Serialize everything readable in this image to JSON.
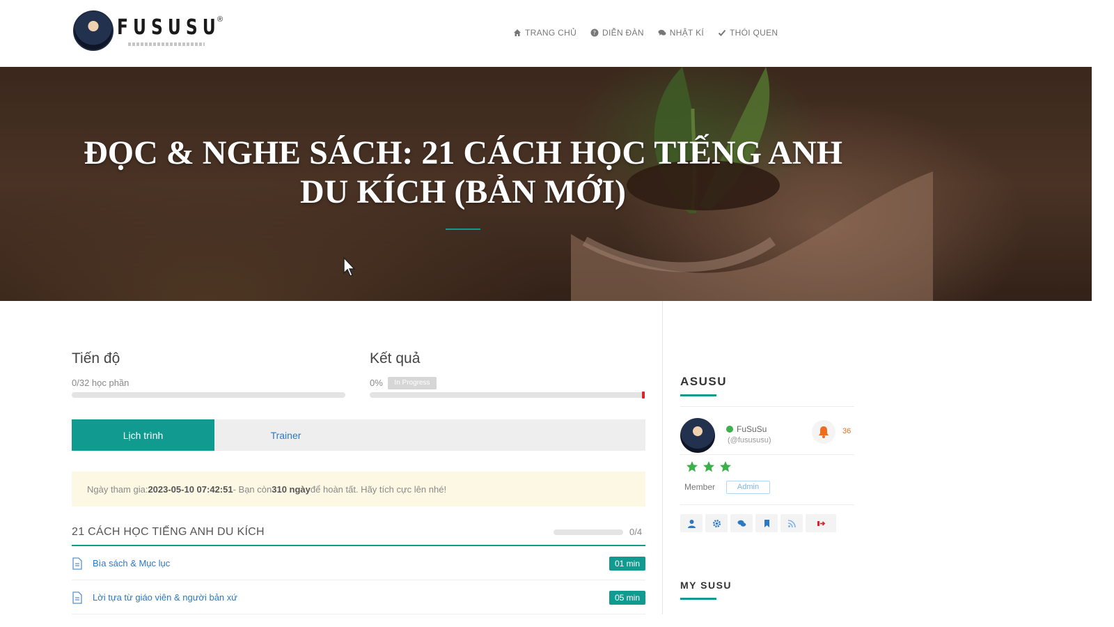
{
  "brand": {
    "logo_text": "FUSUSU",
    "registered_mark": "®"
  },
  "nav": [
    {
      "label": "TRANG CHỦ",
      "icon": "home-icon"
    },
    {
      "label": "DIỄN ĐÀN",
      "icon": "question-circle-icon"
    },
    {
      "label": "NHẬT KÍ",
      "icon": "comments-icon"
    },
    {
      "label": "THÓI QUEN",
      "icon": "check-icon"
    }
  ],
  "hero": {
    "title": "ĐỌC & NGHE SÁCH: 21 CÁCH HỌC TIẾNG ANH DU KÍCH (BẢN MỚI)"
  },
  "progress": {
    "label": "Tiến độ",
    "sub": "0/32 học phần",
    "value": 0
  },
  "result": {
    "label": "Kết quả",
    "percent_text": "0%",
    "badge": "In Progress",
    "value": 0
  },
  "tabs": [
    {
      "label": "Lịch trình",
      "active": true
    },
    {
      "label": "Trainer",
      "active": false
    }
  ],
  "notice": {
    "prefix": "Ngày tham gia: ",
    "join_date": "2023-05-10 07:42:51",
    "middle": " - Bạn còn ",
    "days_left": "310 ngày",
    "suffix": " để hoàn tất. Hãy tích cực lên nhé!"
  },
  "section": {
    "title": "21 CÁCH HỌC TIẾNG ANH DU KÍCH",
    "count": "0/4",
    "progress_value": 0
  },
  "lessons": [
    {
      "title": "Bìa sách & Mục lục",
      "duration": "01 min"
    },
    {
      "title": "Lời tựa từ giáo viên & người bản xứ",
      "duration": "05 min"
    }
  ],
  "sidebar": {
    "profile_heading": "ASUSU",
    "user_name": "FuSuSu",
    "user_handle": "(@fusususu)",
    "notification_count": "36",
    "stars": 3,
    "member_label": "Member",
    "role_badge": "Admin",
    "actions": [
      "user-icon",
      "gear-icon",
      "comments-icon",
      "bookmark-icon",
      "rss-icon",
      "logout-icon"
    ],
    "second_heading": "MY SUSU"
  },
  "colors": {
    "accent": "#119a90",
    "link": "#2b78c5",
    "notice_bg": "#fcf8e3",
    "star": "#3cb04a",
    "alert": "#ef6c1e"
  }
}
